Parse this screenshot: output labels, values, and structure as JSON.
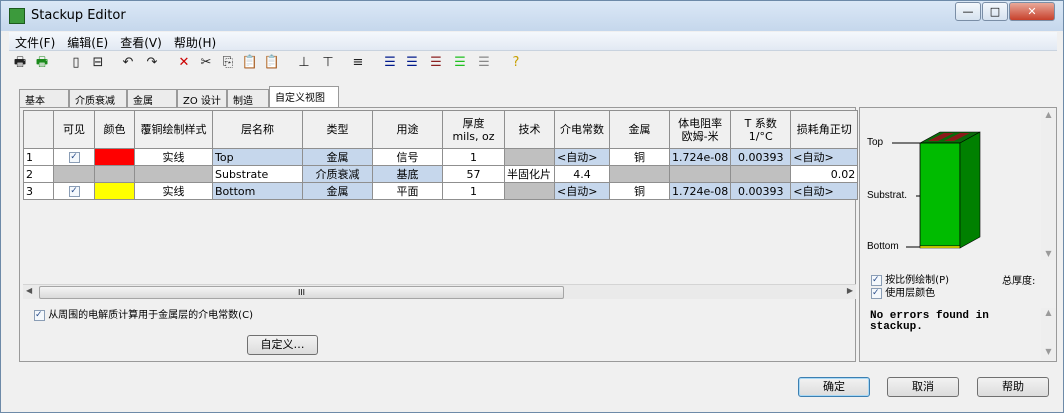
{
  "window": {
    "title": "Stackup Editor",
    "minimize": "—",
    "maximize": "□",
    "close": "✕"
  },
  "menu": [
    "文件(F)",
    "编辑(E)",
    "查看(V)",
    "帮助(H)"
  ],
  "toolbar": [
    {
      "name": "print-icon",
      "glyph": "🖶"
    },
    {
      "name": "print-preview-icon",
      "glyph": "🖶"
    },
    {
      "name": "split-vertical-icon",
      "glyph": "▯"
    },
    {
      "name": "split-horizontal-icon",
      "glyph": "⊟"
    },
    {
      "name": "undo-icon",
      "glyph": "↶"
    },
    {
      "name": "redo-icon",
      "glyph": "↷"
    },
    {
      "name": "delete-icon",
      "glyph": "✕"
    },
    {
      "name": "cut-icon",
      "glyph": "✂"
    },
    {
      "name": "copy-icon",
      "glyph": "⎘"
    },
    {
      "name": "paste-icon",
      "glyph": "📋"
    },
    {
      "name": "paste-special-icon",
      "glyph": "📋"
    },
    {
      "name": "insert-above-icon",
      "glyph": "⊥"
    },
    {
      "name": "insert-below-icon",
      "glyph": "⊤"
    },
    {
      "name": "sort-icon",
      "glyph": "≡"
    },
    {
      "name": "layer-icon",
      "glyph": "☰"
    },
    {
      "name": "layers-blue-icon",
      "glyph": "☰"
    },
    {
      "name": "layers-red-icon",
      "glyph": "☰"
    },
    {
      "name": "layers-green-icon",
      "glyph": "☰"
    },
    {
      "name": "layers-gray-icon",
      "glyph": "☰"
    },
    {
      "name": "help-icon",
      "glyph": "?"
    }
  ],
  "tabs": [
    "基本",
    "介质衰减",
    "金属",
    "ZO 设计",
    "制造",
    "自定义视图"
  ],
  "grid": {
    "headers": [
      "",
      "可见",
      "颜色",
      "覆铜绘制样式",
      "层名称",
      "类型",
      "用途",
      "厚度\nmils, oz",
      "技术",
      "介电常数",
      "金属",
      "体电阻率\n欧姆-米",
      "T 系数\n1/°C",
      "损耗角正切"
    ],
    "rows": [
      {
        "num": "1",
        "visible": true,
        "color": "#ff0000",
        "style": "实线",
        "name": "Top",
        "type": "金属",
        "usage": "信号",
        "thickness": "1",
        "tech": "",
        "dk": "<自动>",
        "metal": "铜",
        "resist": "1.724e-08",
        "tc": "0.00393",
        "loss": "<自动>"
      },
      {
        "num": "2",
        "visible": false,
        "color": "",
        "style": "",
        "name": "Substrate",
        "type": "介质衰减",
        "usage": "基底",
        "thickness": "57",
        "tech": "半固化片",
        "dk": "4.4",
        "metal": "",
        "resist": "",
        "tc": "",
        "loss": "0.02"
      },
      {
        "num": "3",
        "visible": true,
        "color": "#ffff00",
        "style": "实线",
        "name": "Bottom",
        "type": "金属",
        "usage": "平面",
        "thickness": "1",
        "tech": "",
        "dk": "<自动>",
        "metal": "铜",
        "resist": "1.724e-08",
        "tc": "0.00393",
        "loss": "<自动>"
      }
    ]
  },
  "scroll_thumb": "III",
  "calc_checkbox": "从周围的电解质计算用于金属层的介电常数(C)",
  "customize_button": "自定义…",
  "preview": {
    "labels": [
      "Top",
      "Substrat.",
      "Bottom"
    ],
    "scale_checkbox": "按比例绘制(P)",
    "total_label": "总厚度:",
    "layer_color_checkbox": "使用层颜色",
    "message": "No errors found in stackup."
  },
  "buttons": {
    "ok": "确定",
    "cancel": "取消",
    "help": "帮助"
  }
}
